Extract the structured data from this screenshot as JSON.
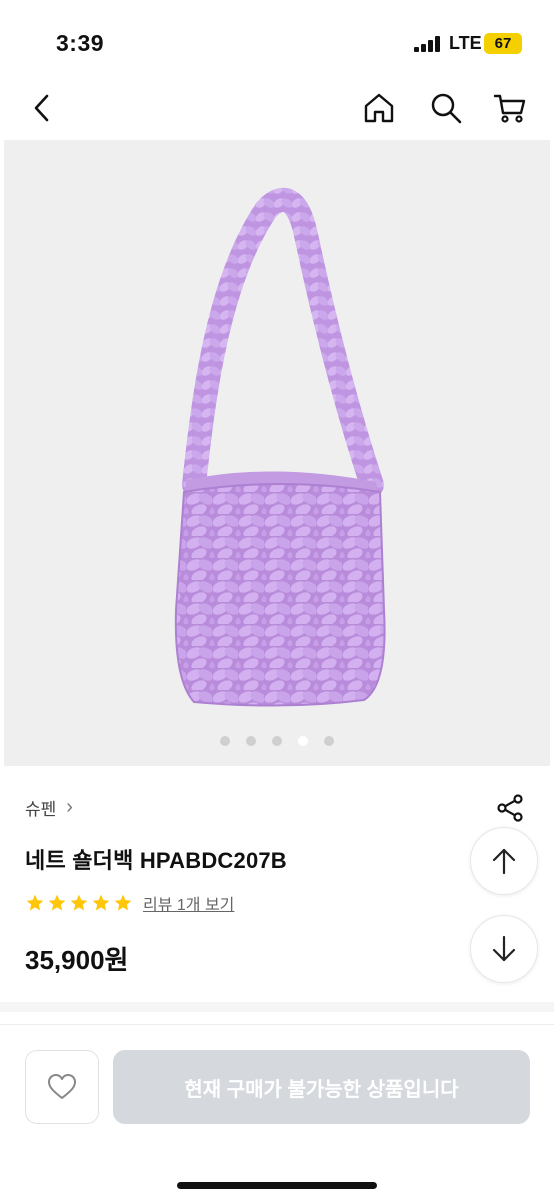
{
  "status": {
    "time": "3:39",
    "network": "LTE",
    "battery": "67"
  },
  "nav": {
    "back_icon": "chevron-left-icon",
    "home_icon": "home-icon",
    "search_icon": "search-icon",
    "cart_icon": "cart-icon"
  },
  "gallery": {
    "total_images": 5,
    "active_index": 3,
    "bag_color": "#c9a2e6"
  },
  "product": {
    "brand": "슈펜",
    "brand_chevron": "›",
    "title": "네트 숄더백  HPABDC207B",
    "rating_stars": 5,
    "review_link": "리뷰 1개 보기",
    "price": "35,900원"
  },
  "actions": {
    "share_icon": "share-icon",
    "scroll_up_icon": "arrow-up-icon",
    "scroll_down_icon": "arrow-down-icon",
    "wishlist_icon": "heart-icon",
    "buy_label": "현재 구매가 불가능한 상품입니다"
  },
  "colors": {
    "star": "#ffc60a",
    "buy_disabled_bg": "#d5d8dc",
    "image_bg": "#efefef"
  }
}
